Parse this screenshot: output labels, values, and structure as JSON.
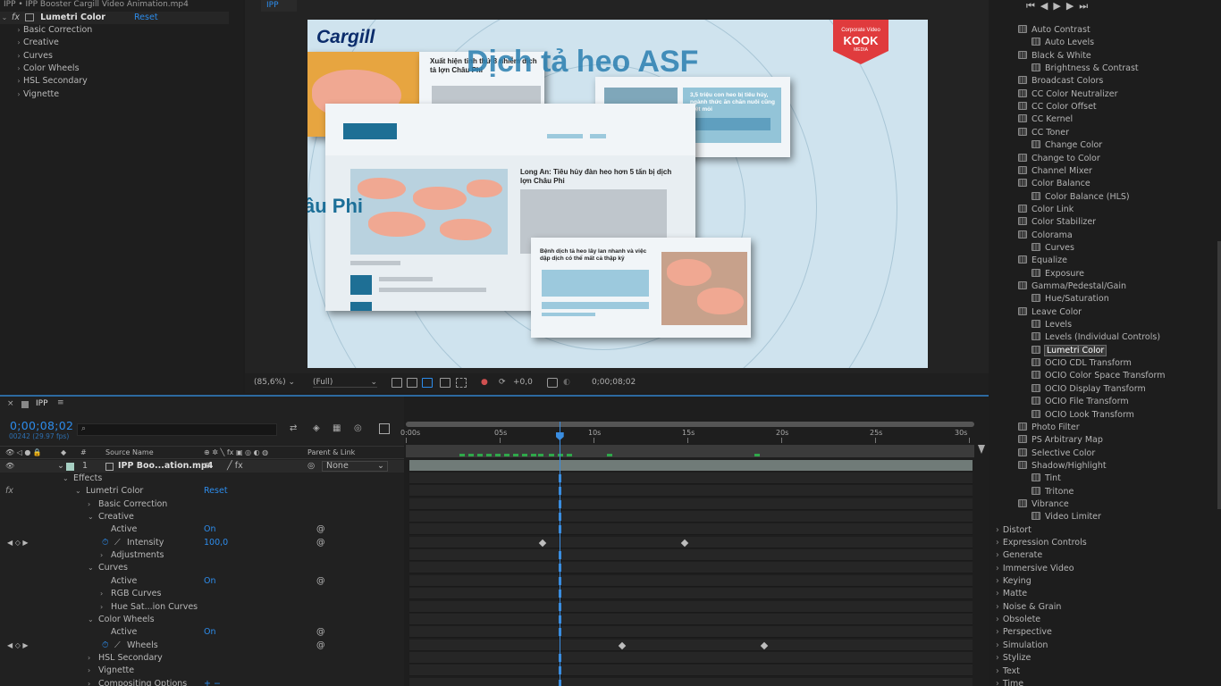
{
  "effect_controls": {
    "title": "IPP • IPP Booster Cargill Video Animation.mp4",
    "effect_name": "Lumetri Color",
    "reset": "Reset",
    "sections": [
      "Basic Correction",
      "Creative",
      "Curves",
      "Color Wheels",
      "HSL Secondary",
      "Vignette"
    ]
  },
  "viewer": {
    "tab": "IPP",
    "zoom": "(85,6%)",
    "quality": "(Full)",
    "exposure": "+0,0",
    "timecode": "0;00;08;02",
    "frame": {
      "logo": "Cargill",
      "headline": "Dịch tả heo ASF",
      "side_text": "âu Phi",
      "badge_top": "Corporate Video",
      "badge_main": "KOOK",
      "badge_sub": "MEDIA",
      "card1_text": "Xuất hiện tỉnh thứ 8 nhiễm dịch tả lợn Châu Phi",
      "card2_text": "3,5 triệu con heo bị tiêu hủy, ngành thức ăn chăn nuôi cũng mệt mỏi",
      "card3_text": "Long An: Tiêu hủy đàn heo hơn 5 tấn bị dịch lợn Châu Phi",
      "card4_text": "Bệnh dịch tả heo lây lan nhanh và việc dập dịch có thể mất cả thập kỷ"
    }
  },
  "timeline": {
    "tab": "IPP",
    "timecode": "0;00;08;02",
    "fps": "00242 (29.97 fps)",
    "col_number": "#",
    "col_source": "Source Name",
    "col_parent": "Parent & Link",
    "layer_number": "1",
    "layer_name": "IPP Boo...ation.mp4",
    "parent_value": "None",
    "ruler": [
      "0:00s",
      "05s",
      "10s",
      "15s",
      "20s",
      "25s",
      "30s"
    ],
    "playhead_fraction": 0.27,
    "rows": [
      {
        "label": "Effects",
        "indent": 1,
        "twirl": "v"
      },
      {
        "label": "Lumetri Color",
        "indent": 2,
        "twirl": "v",
        "value": "Reset",
        "fx": true
      },
      {
        "label": "Basic Correction",
        "indent": 3,
        "twirl": ">"
      },
      {
        "label": "Creative",
        "indent": 3,
        "twirl": "v"
      },
      {
        "label": "Active",
        "indent": 4,
        "value": "On",
        "spiral": true
      },
      {
        "label": "Intensity",
        "indent": 4,
        "value": "100,0",
        "stopwatch": true,
        "spiral": true,
        "keyframes": [
          0.24,
          0.49
        ]
      },
      {
        "label": "Adjustments",
        "indent": 4,
        "twirl": ">"
      },
      {
        "label": "Curves",
        "indent": 3,
        "twirl": "v"
      },
      {
        "label": "Active",
        "indent": 4,
        "value": "On",
        "spiral": true
      },
      {
        "label": "RGB Curves",
        "indent": 4,
        "twirl": ">"
      },
      {
        "label": "Hue Sat...ion Curves",
        "indent": 4,
        "twirl": ">"
      },
      {
        "label": "Color Wheels",
        "indent": 3,
        "twirl": "v"
      },
      {
        "label": "Active",
        "indent": 4,
        "value": "On",
        "spiral": true
      },
      {
        "label": "Wheels",
        "indent": 4,
        "stopwatch": true,
        "spiral": true,
        "keyframes": [
          0.38,
          0.63
        ]
      },
      {
        "label": "HSL Secondary",
        "indent": 3,
        "twirl": ">"
      },
      {
        "label": "Vignette",
        "indent": 3,
        "twirl": ">"
      },
      {
        "label": "Compositing Options",
        "indent": 3,
        "twirl": ">",
        "value": "+ −"
      }
    ]
  },
  "presets": {
    "items": [
      "Auto Contrast",
      "Auto Levels",
      "Black & White",
      "Brightness & Contrast",
      "Broadcast Colors",
      "CC Color Neutralizer",
      "CC Color Offset",
      "CC Kernel",
      "CC Toner",
      "Change Color",
      "Change to Color",
      "Channel Mixer",
      "Color Balance",
      "Color Balance (HLS)",
      "Color Link",
      "Color Stabilizer",
      "Colorama",
      "Curves",
      "Equalize",
      "Exposure",
      "Gamma/Pedestal/Gain",
      "Hue/Saturation",
      "Leave Color",
      "Levels",
      "Levels (Individual Controls)",
      "Lumetri Color",
      "OCIO CDL Transform",
      "OCIO Color Space Transform",
      "OCIO Display Transform",
      "OCIO File Transform",
      "OCIO Look Transform",
      "Photo Filter",
      "PS Arbitrary Map",
      "Selective Color",
      "Shadow/Highlight",
      "Tint",
      "Tritone",
      "Vibrance",
      "Video Limiter"
    ],
    "selected": "Lumetri Color",
    "categories": [
      "Distort",
      "Expression Controls",
      "Generate",
      "Immersive Video",
      "Keying",
      "Matte",
      "Noise & Grain",
      "Obsolete",
      "Perspective",
      "Simulation",
      "Stylize",
      "Text",
      "Time"
    ]
  },
  "colors": {
    "accent": "#2d8ceb",
    "playhead": "#3a8de0",
    "clip": "#707b78"
  }
}
